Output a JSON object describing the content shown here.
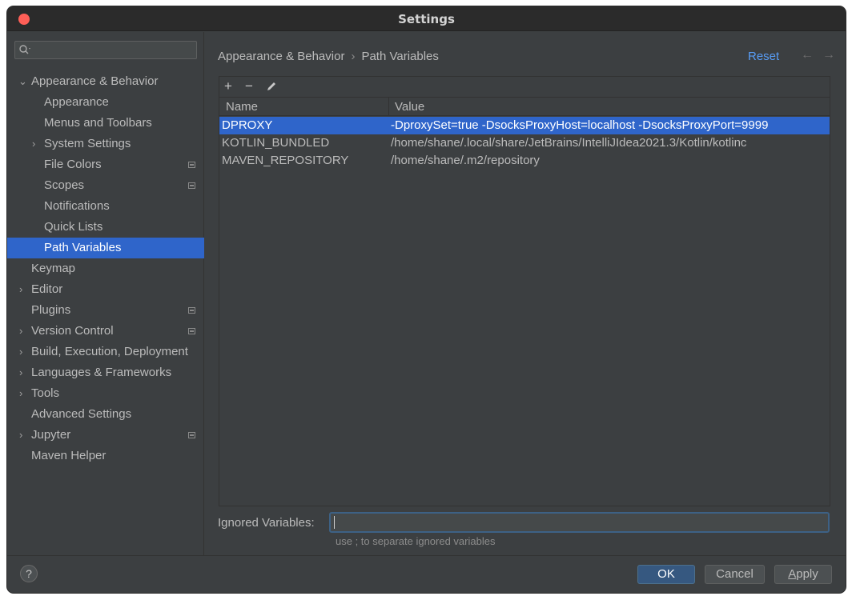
{
  "window": {
    "title": "Settings"
  },
  "search": {
    "placeholder": ""
  },
  "sidebar": {
    "items": [
      {
        "label": "Appearance & Behavior",
        "level": 0,
        "expandable": true,
        "expanded": true,
        "bold": false,
        "project": false
      },
      {
        "label": "Appearance",
        "level": 1,
        "expandable": false,
        "project": false
      },
      {
        "label": "Menus and Toolbars",
        "level": 1,
        "expandable": false,
        "project": false
      },
      {
        "label": "System Settings",
        "level": 1,
        "expandable": true,
        "project": false
      },
      {
        "label": "File Colors",
        "level": 1,
        "expandable": false,
        "project": true
      },
      {
        "label": "Scopes",
        "level": 1,
        "expandable": false,
        "project": true
      },
      {
        "label": "Notifications",
        "level": 1,
        "expandable": false,
        "project": false
      },
      {
        "label": "Quick Lists",
        "level": 1,
        "expandable": false,
        "project": false
      },
      {
        "label": "Path Variables",
        "level": 1,
        "expandable": false,
        "project": false,
        "selected": true
      },
      {
        "label": "Keymap",
        "level": 0,
        "expandable": false,
        "project": false
      },
      {
        "label": "Editor",
        "level": 0,
        "expandable": true,
        "project": false
      },
      {
        "label": "Plugins",
        "level": 0,
        "expandable": false,
        "project": true
      },
      {
        "label": "Version Control",
        "level": 0,
        "expandable": true,
        "project": true
      },
      {
        "label": "Build, Execution, Deployment",
        "level": 0,
        "expandable": true,
        "project": false
      },
      {
        "label": "Languages & Frameworks",
        "level": 0,
        "expandable": true,
        "project": false
      },
      {
        "label": "Tools",
        "level": 0,
        "expandable": true,
        "project": false
      },
      {
        "label": "Advanced Settings",
        "level": 0,
        "expandable": false,
        "project": false
      },
      {
        "label": "Jupyter",
        "level": 0,
        "expandable": true,
        "project": true
      },
      {
        "label": "Maven Helper",
        "level": 0,
        "expandable": false,
        "project": false
      }
    ]
  },
  "header": {
    "breadcrumb_parent": "Appearance & Behavior",
    "breadcrumb_sep": "›",
    "breadcrumb_current": "Path Variables",
    "reset_label": "Reset",
    "back_icon": "←",
    "forward_icon": "→"
  },
  "toolbar": {
    "add_icon": "+",
    "remove_icon": "−",
    "edit_icon": "pencil-icon"
  },
  "table": {
    "columns": [
      "Name",
      "Value"
    ],
    "rows": [
      {
        "name": "DPROXY",
        "value": "-DproxySet=true -DsocksProxyHost=localhost -DsocksProxyPort=9999",
        "selected": true
      },
      {
        "name": "KOTLIN_BUNDLED",
        "value": "/home/shane/.local/share/JetBrains/IntelliJIdea2021.3/Kotlin/kotlinc",
        "selected": false
      },
      {
        "name": "MAVEN_REPOSITORY",
        "value": "/home/shane/.m2/repository",
        "selected": false
      }
    ]
  },
  "ignored": {
    "label": "Ignored Variables:",
    "value": "",
    "hint": "use ; to separate ignored variables"
  },
  "footer": {
    "help_label": "?",
    "ok_label": "OK",
    "cancel_label": "Cancel",
    "apply_first": "A",
    "apply_rest": "pply"
  },
  "colors": {
    "selection": "#2f65ca",
    "accent_link": "#589df6",
    "ok_button": "#365880",
    "panel_bg": "#3c3f41",
    "close_dot": "#ff5f57"
  }
}
